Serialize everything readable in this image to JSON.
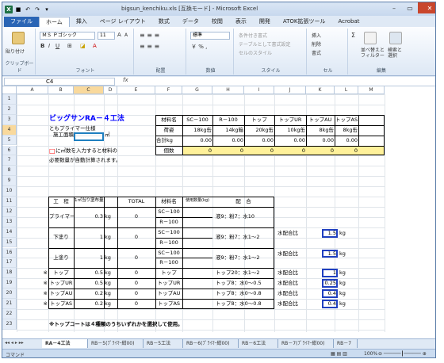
{
  "window": {
    "title": "bigsun_kenchiku.xls [互換モード] - Microsoft Excel"
  },
  "ribbon": {
    "tabs": [
      "ファイル",
      "ホーム",
      "挿入",
      "ページ レイアウト",
      "数式",
      "データ",
      "校閲",
      "表示",
      "開発",
      "ATOK拡張ツール",
      "Acrobat"
    ],
    "clipboard": {
      "paste": "貼り付け",
      "label": "クリップボード"
    },
    "font": {
      "name": "ＭＳ Ｐゴシック",
      "size": "11",
      "label": "フォント"
    },
    "align": {
      "label": "配置"
    },
    "number": {
      "format": "標準",
      "label": "数値"
    },
    "style": {
      "cond": "条件付き書式",
      "table": "テーブルとして書式設定",
      "cell": "セルのスタイル",
      "label": "スタイル"
    },
    "cells": {
      "insert": "挿入",
      "delete": "削除",
      "format": "書式",
      "label": "セル"
    },
    "edit": {
      "sort": "並べ替えと\nフィルター",
      "find": "検索と\n選択",
      "label": "編集"
    }
  },
  "formula_bar": {
    "name_box": "C4",
    "fx": "fx"
  },
  "columns": [
    "A",
    "B",
    "C",
    "D",
    "E",
    "F",
    "G",
    "H",
    "I",
    "J",
    "K",
    "L",
    "M"
  ],
  "rows": [
    "1",
    "2",
    "3",
    "4",
    "5",
    "6",
    "7",
    "8",
    "9",
    "10",
    "11",
    "12",
    "13",
    "14",
    "15",
    "16",
    "17",
    "18",
    "19",
    "20",
    "21",
    "22",
    "23"
  ],
  "sheet": {
    "title": "ビッグサンRA－４工法",
    "subtitle": "ともプライマー仕様",
    "area_label": "施工面積",
    "area_unit": "㎡",
    "note_box": "□",
    "note1": "に㎡数を入力すると材料の",
    "note2": "必要数量が自動計算されます。",
    "materials": {
      "headers": [
        "材料名",
        "SC－100",
        "R－100",
        "トップ",
        "トップUR",
        "トップAU",
        "トップAS"
      ],
      "packing_label": "荷姿",
      "packing": [
        "18kg缶",
        "14kg箱",
        "20kg缶",
        "10kg缶",
        "8kg缶",
        "8kg缶"
      ],
      "total_label": "合計kg",
      "totals": [
        "0.00",
        "0.00",
        "0.00",
        "0.00",
        "0.00",
        "0.00"
      ],
      "count_label": "個数",
      "counts": [
        "0",
        "0",
        "0",
        "0",
        "0",
        "0"
      ]
    },
    "process": {
      "headers": [
        "工　程",
        "1㎡当り塗布量",
        "TOTAL",
        "材料名",
        "使用数量(kg)",
        "配　合"
      ],
      "rows": [
        {
          "mark": "",
          "step": "プライマー",
          "qty": "0.3",
          "unit": "kg",
          "total": "0",
          "mats": [
            "SC－100",
            "R－100"
          ],
          "mix": "液9：粉7：水10"
        },
        {
          "mark": "",
          "step": "下塗り",
          "qty": "1",
          "unit": "kg",
          "total": "0",
          "mats": [
            "SC－100",
            "R－100"
          ],
          "mix": "液9：粉7：水1～2"
        },
        {
          "mark": "",
          "step": "上塗り",
          "qty": "1",
          "unit": "kg",
          "total": "0",
          "mats": [
            "SC－100",
            "R－100"
          ],
          "mix": "液9：粉7：水1～2"
        },
        {
          "mark": "※",
          "step": "トップ",
          "qty": "0.5",
          "unit": "kg",
          "total": "0",
          "mats": [
            "トップ"
          ],
          "mix": "トップ20：水1～2"
        },
        {
          "mark": "※",
          "step": "トップUR",
          "qty": "0.5",
          "unit": "kg",
          "total": "0",
          "mats": [
            "トップUR"
          ],
          "mix": "トップ8：水0～0.5"
        },
        {
          "mark": "※",
          "step": "トップAU",
          "qty": "0.2",
          "unit": "kg",
          "total": "0",
          "mats": [
            "トップAU"
          ],
          "mix": "トップ8：水0～0.8"
        },
        {
          "mark": "※",
          "step": "トップAS",
          "qty": "0.2",
          "unit": "kg",
          "total": "0",
          "mats": [
            "トップAS"
          ],
          "mix": "トップ8：水0～0.8"
        }
      ]
    },
    "water_label": "水配合比",
    "water": [
      {
        "v": "1.5",
        "u": "kg"
      },
      {
        "v": "1.5",
        "u": "kg"
      },
      {
        "v": "1",
        "u": "kg"
      },
      {
        "v": "0.25",
        "u": "kg"
      },
      {
        "v": "0.4",
        "u": "kg"
      },
      {
        "v": "0.4",
        "u": "kg"
      }
    ],
    "footnote": "※トップコートは４種類のうちいずれかを選択して使用。"
  },
  "sheet_tabs": [
    "RA－4工法",
    "RB－5(ﾌﾟﾗｲﾏｰ紺00)",
    "RB－5工法",
    "RB－6(ﾌﾟﾗｲﾏｰ紺00)",
    "RB－6工法",
    "RB－7(ﾌﾟﾗｲﾏｰ紺00)",
    "RB－7"
  ],
  "status": {
    "mode": "コマンド",
    "zoom": "100%"
  },
  "colors": {
    "accent": "#2a65b5",
    "title_blue": "#0000ff",
    "input_yellow": "#fff19a",
    "red": "#ff0000",
    "excel_green": "#1e7145"
  }
}
